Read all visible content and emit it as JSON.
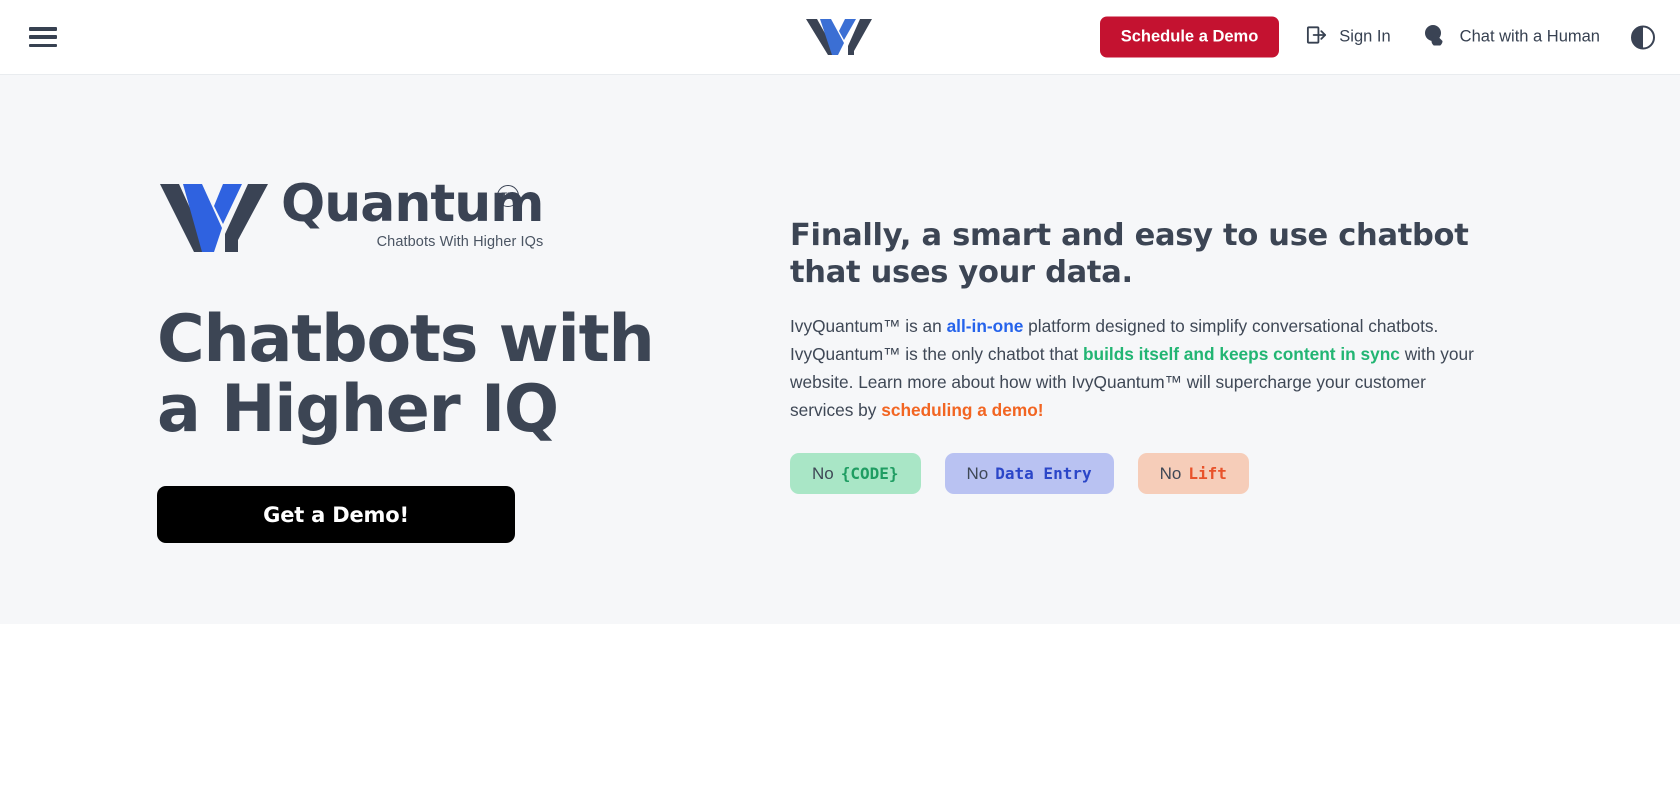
{
  "header": {
    "menu_icon": "hamburger-menu-icon",
    "logo_alt": "IvyQuantum logo",
    "demo_button": "Schedule a Demo",
    "sign_in": "Sign In",
    "sign_in_icon": "sign-in-arrow-icon",
    "chat": "Chat with a Human",
    "chat_icon": "chat-bubble-icon",
    "theme_icon": "theme-contrast-toggle-icon",
    "demo_button_color": "#C41230"
  },
  "hero": {
    "logo_word": "Quantum",
    "logo_tagline": "Chatbots With Higher IQs",
    "trademark": "TM",
    "title": "Chatbots with a Higher IQ",
    "cta": "Get a Demo!",
    "right_title": "Finally, a smart and easy to use chatbot that uses your data.",
    "paragraph": {
      "p1": "IvyQuantum™ is an ",
      "hl1": "all-in-one",
      "p2": " platform designed to simplify conversational chatbots. IvyQuantum™ is the only chatbot that ",
      "hl2": "builds itself and keeps content in sync",
      "p3": " with your website. Learn more about how with IvyQuantum™ will supercharge your customer services by ",
      "hl3": "scheduling a demo!"
    },
    "pills": [
      {
        "prefix": "No",
        "code": "{CODE}"
      },
      {
        "prefix": "No",
        "code": "Data Entry"
      },
      {
        "prefix": "No",
        "code": "Lift"
      }
    ],
    "colors": {
      "background": "#f6f7f9",
      "headline": "#3c4554",
      "blue": "#2563eb",
      "green": "#22b573",
      "orange": "#f26522",
      "pill_green": "#a9e6c6",
      "pill_blue": "#b9c2f2",
      "pill_peach": "#f6cdb9",
      "cta_background": "#000000"
    }
  }
}
